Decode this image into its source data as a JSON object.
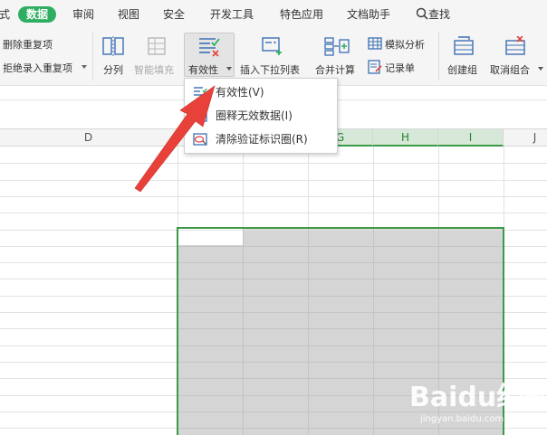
{
  "menu": {
    "partial_left": "式",
    "tabs": [
      "数据",
      "审阅",
      "视图",
      "安全",
      "开发工具",
      "特色应用",
      "文档助手"
    ],
    "search": "查找"
  },
  "ribbon": {
    "remove_duplicates": "删除重复项",
    "reject_duplicates": "拒绝录入重复项",
    "split_column": "分列",
    "smart_fill": "智能填充",
    "validity": "有效性",
    "insert_dropdown": "插入下拉列表",
    "merge_calc": "合并计算",
    "what_if": "模拟分析",
    "record_sheet": "记录单",
    "create_group": "创建组",
    "ungroup": "取消组合"
  },
  "columns": [
    "D",
    "G",
    "H",
    "I",
    "J"
  ],
  "dropdown": {
    "items": [
      "有效性(V)",
      "圈释无效数据(I)",
      "清除验证标识圈(R)"
    ]
  },
  "watermark": {
    "brand": "Baidu经验",
    "url": "jingyan.baidu.com"
  },
  "colors": {
    "accent_green": "#2fae62",
    "selection_green": "#3c9a47",
    "annotation_red": "#e8413a"
  }
}
